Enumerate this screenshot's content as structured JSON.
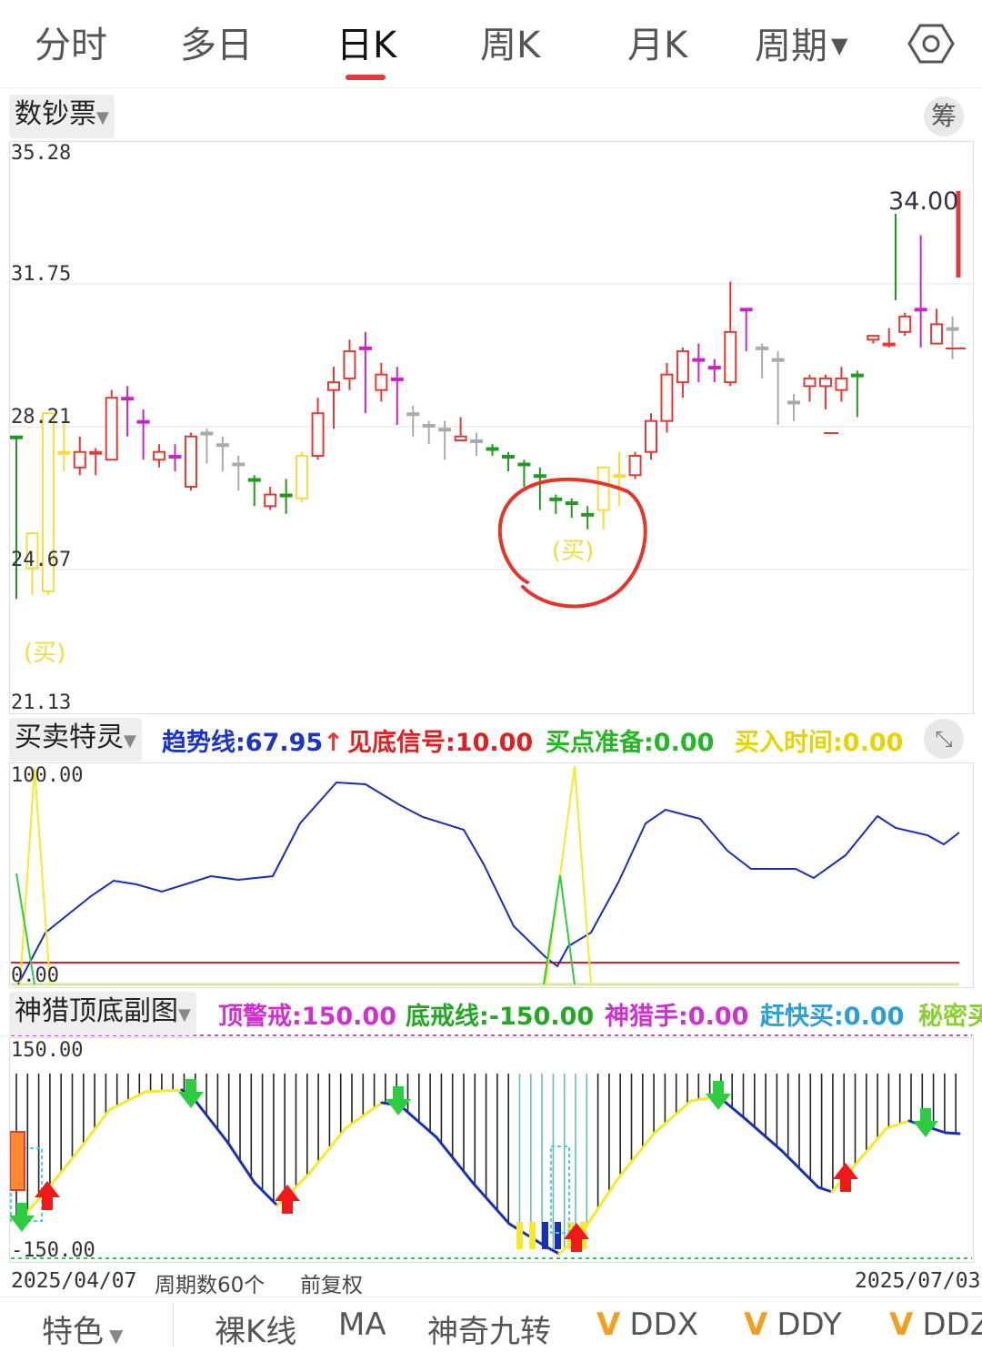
{
  "tabs": [
    {
      "label": "分时"
    },
    {
      "label": "多日"
    },
    {
      "label": "日K",
      "active": true
    },
    {
      "label": "周K"
    },
    {
      "label": "月K"
    },
    {
      "label": "周期"
    }
  ],
  "settings_icon": "settings-hexagon-icon",
  "main_chart": {
    "indicator_selector": "数钞票",
    "chip_button": "筹",
    "y_axis": [
      "35.28",
      "31.75",
      "28.21",
      "24.67",
      "21.13"
    ],
    "high_label": "34.00",
    "buy_label": "(买)",
    "buy_label_left": "(买)"
  },
  "sub_chart1": {
    "name": "买卖特灵",
    "items": [
      {
        "label": "趋势线:67.95",
        "arrow": "↑",
        "color": "#1a33c8"
      },
      {
        "label": "见底信号:10.00",
        "color": "#e02020"
      },
      {
        "label": "买点准备:0.00",
        "color": "#22b822"
      },
      {
        "label": "买入时间:0.00",
        "color": "#e6d400"
      }
    ],
    "y_axis": [
      "100.00",
      "0.00"
    ],
    "expand_icon": "expand-icon"
  },
  "sub_chart2": {
    "name": "神猎顶底副图",
    "items": [
      {
        "label": "顶警戒:150.00",
        "color": "#d030d0"
      },
      {
        "label": "底戒线:-150.00",
        "color": "#22a822"
      },
      {
        "label": "神猎手:0.00",
        "color": "#d030d0"
      },
      {
        "label": "赶快买:0.00",
        "color": "#2aa0d8"
      },
      {
        "label": "秘密买",
        "color": "#8ad030"
      }
    ],
    "y_axis": [
      "150.00",
      "-150.00"
    ]
  },
  "footer": {
    "start_date": "2025/04/07",
    "period_count": "周期数60个",
    "adjust": "前复权",
    "end_date": "2025/07/03"
  },
  "bottom_bar": [
    {
      "label": "特色",
      "dropdown": true
    },
    {
      "label": "裸K线"
    },
    {
      "label": "MA"
    },
    {
      "label": "神奇九转"
    },
    {
      "label": "DDX",
      "checked": true
    },
    {
      "label": "DDY",
      "checked": true
    },
    {
      "label": "DDZ",
      "checked": true
    }
  ],
  "colors": {
    "up": "#e53935",
    "down": "#1f9a1f",
    "magenta": "#cc22cc",
    "gray": "#aaaaaa",
    "yellow": "#f5dc3a",
    "blue": "#1a2fb8"
  }
}
